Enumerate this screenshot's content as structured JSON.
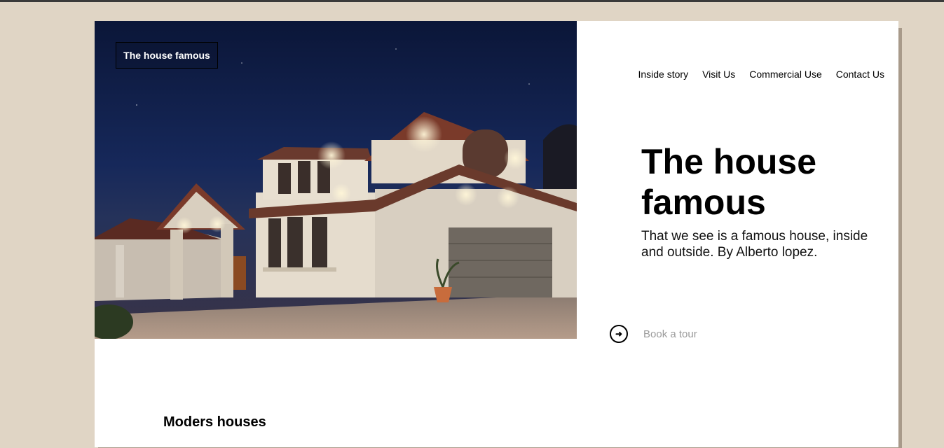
{
  "brand": {
    "logo_text": "The house famous"
  },
  "nav": {
    "items": [
      {
        "label": "Inside story"
      },
      {
        "label": "Visit Us"
      },
      {
        "label": "Commercial Use"
      },
      {
        "label": "Contact Us"
      }
    ]
  },
  "hero": {
    "image_icon": "house-photo",
    "title": "The house famous",
    "subtitle": "That we see is a famous house, inside and outside. By Alberto lopez.",
    "cta": {
      "label": "Book a tour",
      "icon": "arrow-circle-right-icon"
    }
  },
  "sections": {
    "modern_title": "Moders houses"
  },
  "colors": {
    "page_background": "#e0d5c5",
    "card_background": "#ffffff",
    "card_shadow": "#a89a8a",
    "cta_label": "#9a9a9a",
    "night_sky": "#0b1638"
  }
}
